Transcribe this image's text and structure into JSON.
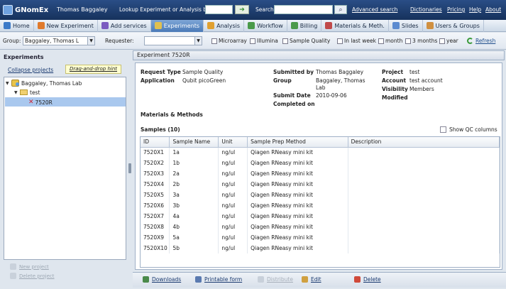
{
  "app": {
    "name": "GNomEx",
    "user": "Thomas Baggaley",
    "lookup_label": "Lookup Experiment or Analysis by #",
    "lookup_value": "",
    "search_label": "Search",
    "search_value": "",
    "advanced_search": "Advanced search",
    "links": [
      "Dictionaries",
      "Pricing",
      "Help",
      "About"
    ]
  },
  "nav": [
    {
      "label": "Home",
      "icon": "home-icon",
      "color": "#3c7ac8"
    },
    {
      "label": "New Experiment",
      "icon": "flask-icon",
      "color": "#e07a2c"
    },
    {
      "label": "Add services",
      "icon": "plus-icon",
      "color": "#7a5ac0"
    },
    {
      "label": "Experiments",
      "icon": "flask-icon",
      "color": "#e0c050",
      "active": true
    },
    {
      "label": "Analysis",
      "icon": "analysis-icon",
      "color": "#e0a030"
    },
    {
      "label": "Workflow",
      "icon": "workflow-icon",
      "color": "#4a9a4a"
    },
    {
      "label": "Billing",
      "icon": "billing-icon",
      "color": "#4a9a4a"
    },
    {
      "label": "Materials & Meth.",
      "icon": "materials-icon",
      "color": "#c04a4a"
    },
    {
      "label": "Slides",
      "icon": "slides-icon",
      "color": "#5a8ad0"
    },
    {
      "label": "Users & Groups",
      "icon": "users-icon",
      "color": "#d09040"
    }
  ],
  "filters": {
    "group_label": "Group:",
    "group_value": "Baggaley, Thomas L",
    "requester_label": "Requester:",
    "requester_value": "",
    "checks_a": [
      "Microarray",
      "Illumina",
      "Sample Quality"
    ],
    "checks_b": [
      "In last week",
      "month",
      "3 months",
      "year"
    ],
    "refresh": "Refresh"
  },
  "left": {
    "title": "Experiments",
    "collapse": "Collapse projects",
    "dnd_hint": "Drag-and-drop hint",
    "tree": {
      "lab": "Baggaley, Thomas Lab",
      "project": "test",
      "experiment": "7520R"
    },
    "bottom": [
      "New project",
      "Delete project"
    ]
  },
  "experiment": {
    "header": "Experiment 7520R",
    "request_type_label": "Request Type",
    "request_type": "Sample Quality",
    "application_label": "Application",
    "application": "Qubit picoGreen",
    "submitted_by_label": "Submitted by",
    "submitted_by": "Thomas Baggaley",
    "group_label": "Group",
    "group": "Baggaley, Thomas Lab",
    "submit_date_label": "Submit Date",
    "submit_date": "2010-09-06",
    "completed_label": "Completed on",
    "completed": "",
    "project_label": "Project",
    "project": "test",
    "account_label": "Account",
    "account": "test account",
    "visibility_label": "Visibility",
    "visibility": "Members",
    "modified_label": "Modified",
    "modified": "",
    "materials": "Materials & Methods",
    "samples_label": "Samples (10)",
    "show_qc": "Show QC columns",
    "columns": [
      "ID",
      "Sample Name",
      "Unit",
      "Sample Prep Method",
      "Description"
    ],
    "samples": [
      [
        "7520X1",
        "1a",
        "ng/ul",
        "Qiagen RNeasy mini kit",
        ""
      ],
      [
        "7520X2",
        "1b",
        "ng/ul",
        "Qiagen RNeasy mini kit",
        ""
      ],
      [
        "7520X3",
        "2a",
        "ng/ul",
        "Qiagen RNeasy mini kit",
        ""
      ],
      [
        "7520X4",
        "2b",
        "ng/ul",
        "Qiagen RNeasy mini kit",
        ""
      ],
      [
        "7520X5",
        "3a",
        "ng/ul",
        "Qiagen RNeasy mini kit",
        ""
      ],
      [
        "7520X6",
        "3b",
        "ng/ul",
        "Qiagen RNeasy mini kit",
        ""
      ],
      [
        "7520X7",
        "4a",
        "ng/ul",
        "Qiagen RNeasy mini kit",
        ""
      ],
      [
        "7520X8",
        "4b",
        "ng/ul",
        "Qiagen RNeasy mini kit",
        ""
      ],
      [
        "7520X9",
        "5a",
        "ng/ul",
        "Qiagen RNeasy mini kit",
        ""
      ],
      [
        "7520X10",
        "5b",
        "ng/ul",
        "Qiagen RNeasy mini kit",
        ""
      ]
    ]
  },
  "actions": [
    {
      "label": "Downloads",
      "icon": "download-icon",
      "color": "#4a8a4a",
      "enabled": true
    },
    {
      "label": "Printable form",
      "icon": "print-icon",
      "color": "#5a7ab0",
      "enabled": true
    },
    {
      "label": "Distribute",
      "icon": "distribute-icon",
      "color": "#c8d0da",
      "enabled": false
    },
    {
      "label": "Edit",
      "icon": "edit-icon",
      "color": "#d0a040",
      "enabled": true
    },
    {
      "label": "Delete",
      "icon": "delete-icon",
      "color": "#d04a3a",
      "enabled": true
    }
  ]
}
